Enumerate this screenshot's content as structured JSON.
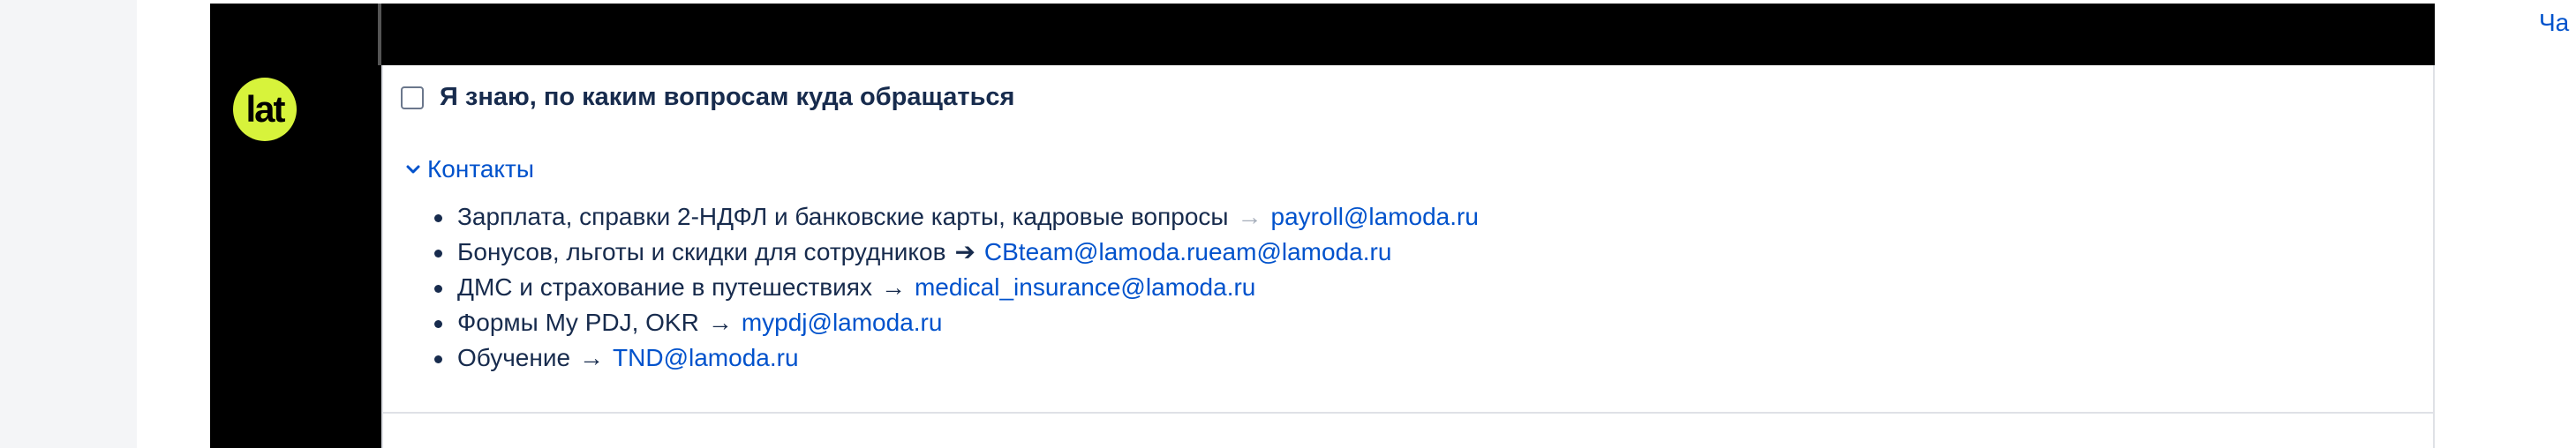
{
  "side_link": "Ча",
  "checkbox": {
    "label": "Я знаю, по каким вопросам куда обращаться",
    "checked": false
  },
  "logo_text": "lat",
  "expand": {
    "label": "Контакты",
    "icon": "chevron-down-icon"
  },
  "contacts": [
    {
      "text": "Зарплата, справки 2-НДФЛ и банковские карты, кадровые вопросы",
      "arrow": "→",
      "email": "payroll@lamoda.ru"
    },
    {
      "text": "Бонусов, льготы и скидки для сотрудников",
      "arrow": "➔",
      "email": "CBteam@lamoda.rueam@lamoda.ru"
    },
    {
      "text": "ДМС и страхование в путешествиях",
      "arrow": "→",
      "email": "medical_insurance@lamoda.ru"
    },
    {
      "text": "Формы My PDJ, OKR",
      "arrow": "→",
      "email": "mypdj@lamoda.ru"
    },
    {
      "text": "Обучение",
      "arrow": "→",
      "email": "TND@lamoda.ru"
    }
  ],
  "colors": {
    "logo_bg": "#d7f33b",
    "link": "#0052cc",
    "text": "#172b4d"
  }
}
